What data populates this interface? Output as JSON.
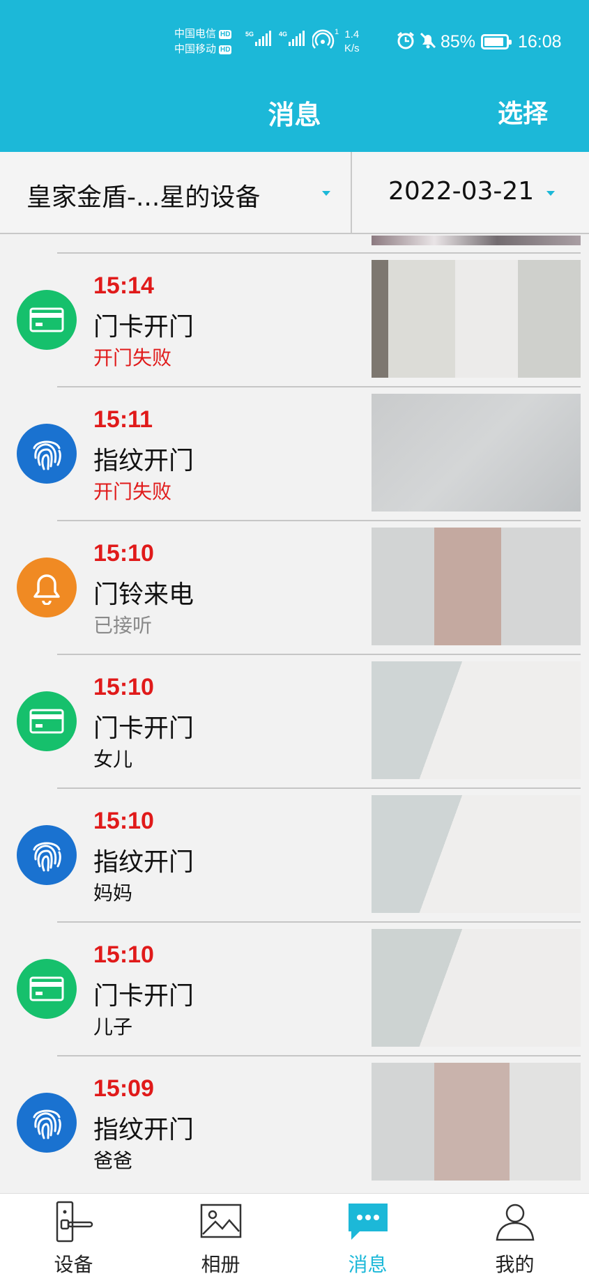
{
  "status_bar": {
    "carrier_1": "中国电信",
    "carrier_2": "中国移动",
    "hd_badge": "HD",
    "net_5g": "5G",
    "net_4g": "4G",
    "hotspot_count": "1",
    "speed_value": "1.4",
    "speed_unit": "K/s",
    "battery_percent": "85%",
    "battery_level": 0.85,
    "time": "16:08"
  },
  "header": {
    "title": "消息",
    "select_label": "选择"
  },
  "filters": {
    "device": "皇家金盾-...星的设备",
    "date": "2022-03-21"
  },
  "colors": {
    "accent": "#1cb8d8",
    "time_red": "#e01a1a",
    "card_green": "#16c06c",
    "fingerprint_blue": "#1a72d0",
    "doorbell_orange": "#f08a23",
    "fail_red": "#e01a1a",
    "muted_gray": "#8a8a8a"
  },
  "messages": [
    {
      "time": "15:14",
      "event": "门卡开门",
      "status": "开门失败",
      "icon": "card-icon"
    },
    {
      "time": "15:11",
      "event": "指纹开门",
      "status": "开门失败",
      "icon": "fingerprint-icon"
    },
    {
      "time": "15:10",
      "event": "门铃来电",
      "status": "已接听",
      "icon": "bell-icon"
    },
    {
      "time": "15:10",
      "event": "门卡开门",
      "status": "女儿",
      "icon": "card-icon"
    },
    {
      "time": "15:10",
      "event": "指纹开门",
      "status": "妈妈",
      "icon": "fingerprint-icon"
    },
    {
      "time": "15:10",
      "event": "门卡开门",
      "status": "儿子",
      "icon": "card-icon"
    },
    {
      "time": "15:09",
      "event": "指纹开门",
      "status": "爸爸",
      "icon": "fingerprint-icon"
    }
  ],
  "nav": [
    {
      "label": "设备",
      "icon": "door-lock-icon",
      "active": false
    },
    {
      "label": "相册",
      "icon": "image-icon",
      "active": false
    },
    {
      "label": "消息",
      "icon": "chat-bubble-icon",
      "active": true
    },
    {
      "label": "我的",
      "icon": "person-icon",
      "active": false
    }
  ]
}
